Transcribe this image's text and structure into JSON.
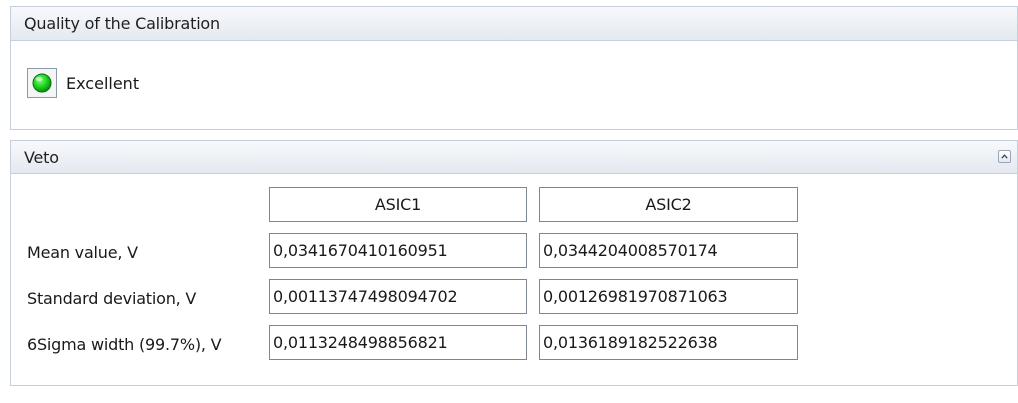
{
  "quality": {
    "title": "Quality of the Calibration",
    "status": {
      "icon": "green-status-led-icon",
      "color": "#1fd61f",
      "label": "Excellent"
    }
  },
  "veto": {
    "title": "Veto",
    "collapse_icon": "chevron-up-icon",
    "columns": [
      "ASIC1",
      "ASIC2"
    ],
    "rows": [
      {
        "label": "Mean value, V",
        "values": [
          "0,0341670410160951",
          "0,0344204008570174"
        ]
      },
      {
        "label": "Standard deviation, V",
        "values": [
          "0,00113747498094702",
          "0,00126981970871063"
        ]
      },
      {
        "label": "6Sigma width (99.7%), V",
        "values": [
          "0,0113248498856821",
          "0,0136189182522638"
        ]
      }
    ]
  }
}
